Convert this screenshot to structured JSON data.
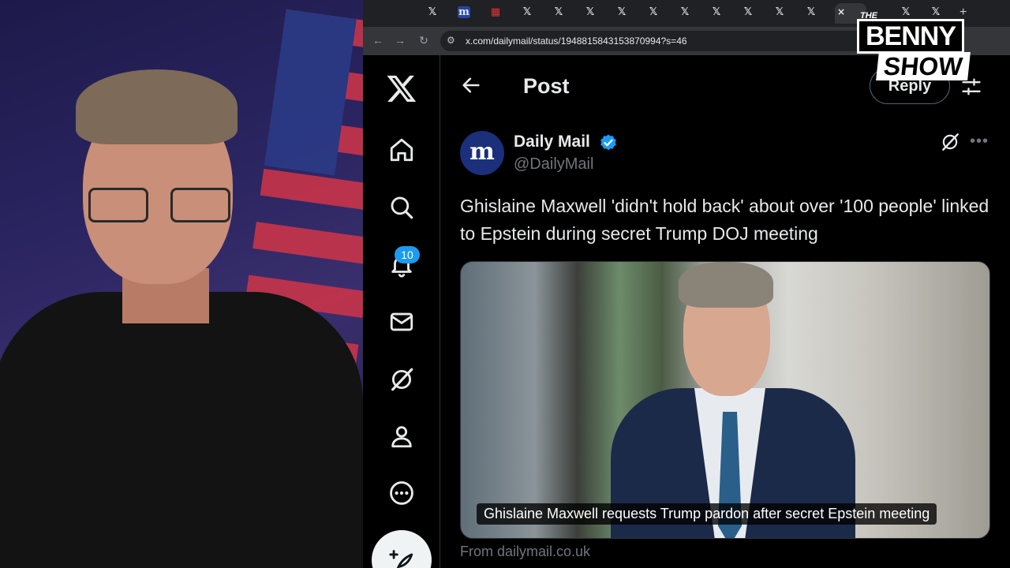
{
  "browser": {
    "tabs": [
      {
        "icon": "x-logo-icon",
        "glyph": "𝕏"
      },
      {
        "icon": "daily-mail-icon",
        "glyph": "m"
      },
      {
        "icon": "calendar-icon",
        "glyph": "▦"
      },
      {
        "icon": "x-logo-icon",
        "glyph": "𝕏"
      },
      {
        "icon": "x-logo-icon",
        "glyph": "𝕏"
      },
      {
        "icon": "x-logo-icon",
        "glyph": "𝕏"
      },
      {
        "icon": "x-logo-icon",
        "glyph": "𝕏"
      },
      {
        "icon": "x-logo-icon",
        "glyph": "𝕏"
      },
      {
        "icon": "x-logo-icon",
        "glyph": "𝕏"
      },
      {
        "icon": "x-logo-icon",
        "glyph": "𝕏"
      },
      {
        "icon": "x-logo-icon",
        "glyph": "𝕏"
      },
      {
        "icon": "x-logo-icon",
        "glyph": "𝕏"
      },
      {
        "icon": "x-logo-icon",
        "glyph": "𝕏"
      },
      {
        "icon": "x-logo-icon",
        "glyph": "𝕏"
      },
      {
        "icon": "x-logo-icon",
        "glyph": "𝕏"
      }
    ],
    "active_tab_close": "×",
    "new_tab": "+",
    "url": "x.com/dailymail/status/1948815843153870994?s=46"
  },
  "x_app": {
    "notifications_count": "10",
    "page_title": "Post",
    "reply_button": "Reply",
    "post": {
      "avatar_letter": "m",
      "author_name": "Daily Mail",
      "handle": "@DailyMail",
      "text": "Ghislaine Maxwell 'didn't hold back' about over '100 people' linked to Epstein during secret Trump DOJ meeting",
      "media_caption": "Ghislaine Maxwell requests Trump pardon after secret Epstein meeting",
      "link_source": "From dailymail.co.uk"
    }
  },
  "show_logo": {
    "line1": "THE",
    "line2": "BENNY",
    "line3": "SHOW"
  },
  "colors": {
    "x_blue": "#1d9bf0",
    "x_text": "#e7e9ea",
    "x_muted": "#71767b",
    "chrome_bg": "#202124"
  }
}
